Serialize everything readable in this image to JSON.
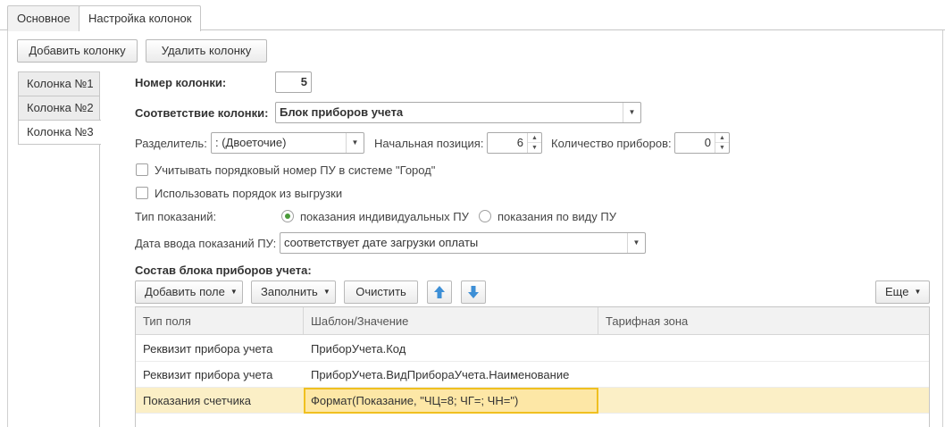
{
  "tabs": [
    {
      "label": "Основное",
      "active": false
    },
    {
      "label": "Настройка колонок",
      "active": true
    }
  ],
  "toolbar": {
    "add_column": "Добавить колонку",
    "delete_column": "Удалить колонку"
  },
  "columns": [
    {
      "label": "Колонка №1",
      "active": false
    },
    {
      "label": "Колонка №2",
      "active": false
    },
    {
      "label": "Колонка №3",
      "active": true
    }
  ],
  "form": {
    "column_number_label": "Номер колонки:",
    "column_number_value": "5",
    "mapping_label": "Соответствие колонки:",
    "mapping_value": "Блок приборов учета",
    "separator_label": "Разделитель:",
    "separator_value": ": (Двоеточие)",
    "start_pos_label": "Начальная позиция:",
    "start_pos_value": "6",
    "device_count_label": "Количество приборов:",
    "device_count_value": "0",
    "checkbox1_label": "Учитывать порядковый номер ПУ в системе \"Город\"",
    "checkbox1_checked": false,
    "checkbox2_label": "Использовать порядок из выгрузки",
    "checkbox2_checked": false,
    "reading_type_label": "Тип показаний:",
    "radio1_label": "показания индивидуальных ПУ",
    "radio1_checked": true,
    "radio2_label": "показания по виду ПУ",
    "radio2_checked": false,
    "date_label": "Дата ввода показаний ПУ:",
    "date_value": "соответствует дате загрузки оплаты",
    "block_title": "Состав блока приборов учета:"
  },
  "table_toolbar": {
    "add_field": "Добавить поле",
    "fill": "Заполнить",
    "clear": "Очистить",
    "more": "Еще"
  },
  "table": {
    "headers": [
      "Тип поля",
      "Шаблон/Значение",
      "Тарифная зона"
    ],
    "rows": [
      {
        "type": "Реквизит прибора учета",
        "template": "ПриборУчета.Код",
        "zone": "",
        "selected": false
      },
      {
        "type": "Реквизит прибора учета",
        "template": "ПриборУчета.ВидПрибораУчета.Наименование",
        "zone": "",
        "selected": false
      },
      {
        "type": "Показания счетчика",
        "template": "Формат(Показание, \"ЧЦ=8; ЧГ=; ЧН=\")",
        "zone": "",
        "selected": true
      }
    ]
  },
  "colors": {
    "selected_row": "#fbefc6",
    "edit_cell": "#fde7a6",
    "edit_border": "#f0c020",
    "radio_dot": "#4a9a3a",
    "arrow_icon": "#3d8fd6"
  }
}
